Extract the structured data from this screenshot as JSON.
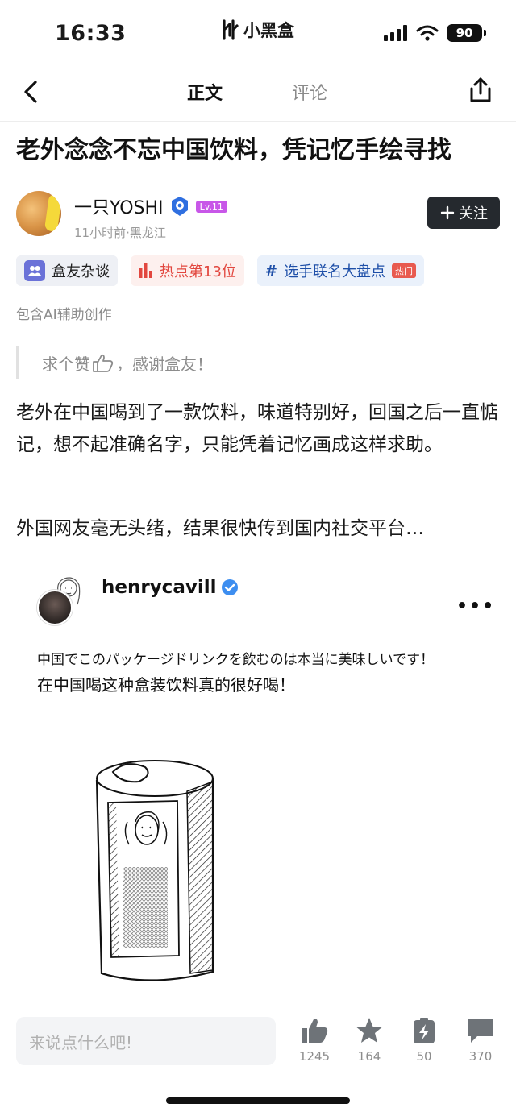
{
  "status_bar": {
    "time": "16:33",
    "app_name": "小黑盒",
    "battery": "90"
  },
  "nav": {
    "tab_main": "正文",
    "tab_comments": "评论"
  },
  "article": {
    "title": "老外念念不忘中国饮料，凭记忆手绘寻找",
    "author": {
      "name": "一只YOSHI",
      "level": "Lv.11",
      "meta": "11小时前·黑龙江"
    },
    "follow_label": "关注",
    "tags": [
      {
        "label": "盒友杂谈",
        "icon": "group-icon"
      },
      {
        "label": "热点第13位",
        "icon": "bar-chart-icon"
      },
      {
        "label": "选手联名大盘点",
        "icon": "hashtag-icon",
        "badge": "热门"
      }
    ],
    "ai_note": "包含AI辅助创作",
    "quote_before": "求个赞",
    "quote_after": "，感谢盒友！",
    "paragraph_1": "老外在中国喝到了一款饮料，味道特别好，回国之后一直惦记，想不起准确名字，只能凭着记忆画成这样求助。",
    "paragraph_2": "外国网友毫无头绪，结果很快传到国内社交平台…"
  },
  "embed": {
    "username": "henrycavill",
    "more": "•••",
    "caption_jp": "中国でこのパッケージドリンクを飲むのは本当に美味しいです！",
    "caption_cn": "在中国喝这种盒装饮料真的很好喝！"
  },
  "bottom_bar": {
    "comment_placeholder": "来说点什么吧!",
    "like_count": "1245",
    "favorite_count": "164",
    "charge_count": "50",
    "comment_count": "370"
  },
  "colors": {
    "follow_bg": "#25292e",
    "level_badge": "#c857e8",
    "hot_tag_text": "#e2473f",
    "topic_tag_text": "#1e4fa8",
    "verified_blue": "#3d8ef0"
  }
}
